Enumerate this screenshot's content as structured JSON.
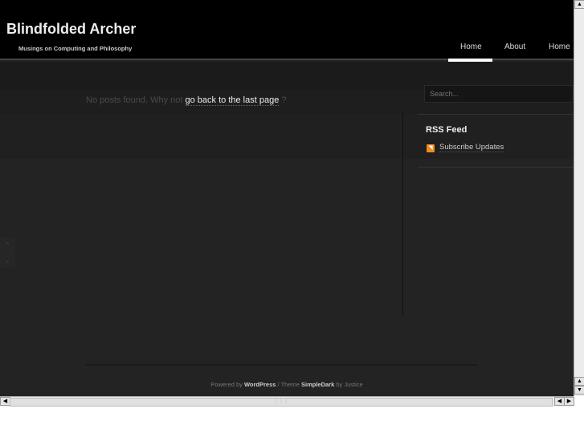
{
  "site": {
    "title": "Blindfolded Archer",
    "tagline": "Musings on Computing and Philosophy"
  },
  "nav": [
    {
      "label": "Home",
      "active": true
    },
    {
      "label": "About"
    },
    {
      "label": "Home"
    }
  ],
  "main": {
    "message_prefix": "No posts found. Why not",
    "message_link": "go back to the last page",
    "message_suffix": "?"
  },
  "sidebar": {
    "search_placeholder": "Search...",
    "rss_title": "RSS Feed",
    "rss_link": "Subscribe Updates"
  },
  "footer": {
    "powered": "Powered by",
    "wordpress": "WordPress",
    "theme": "/ Theme",
    "theme_name": "SimpleDark",
    "by": "by Justice"
  },
  "colors": {
    "header": "#000000",
    "body": "#232323",
    "rss": "#f08a1c"
  }
}
